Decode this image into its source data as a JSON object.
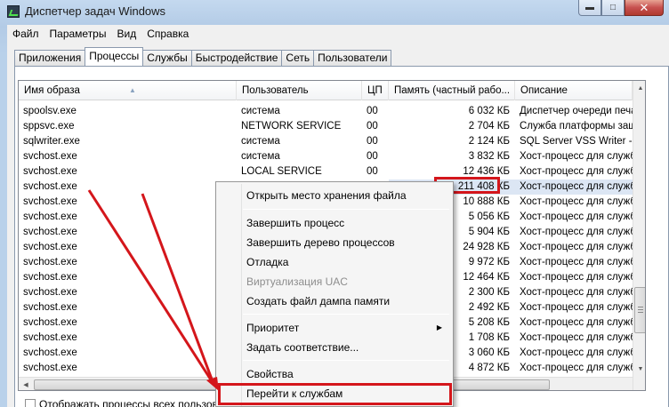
{
  "window": {
    "title": "Диспетчер задач Windows",
    "min_glyph": "▬",
    "max_glyph": "□",
    "close_glyph": "✕"
  },
  "menu": [
    "Файл",
    "Параметры",
    "Вид",
    "Справка"
  ],
  "tabs": [
    "Приложения",
    "Процессы",
    "Службы",
    "Быстродействие",
    "Сеть",
    "Пользователи"
  ],
  "active_tab": "Процессы",
  "columns": [
    "Имя образа",
    "Пользователь",
    "ЦП",
    "Память (частный рабо...",
    "Описание"
  ],
  "rows": [
    {
      "name": "spoolsv.exe",
      "user": "система",
      "cpu": "00",
      "mem": "6 032 КБ",
      "desc": "Диспетчер очереди печа"
    },
    {
      "name": "sppsvc.exe",
      "user": "NETWORK SERVICE",
      "cpu": "00",
      "mem": "2 704 КБ",
      "desc": "Служба платформы защ"
    },
    {
      "name": "sqlwriter.exe",
      "user": "система",
      "cpu": "00",
      "mem": "2 124 КБ",
      "desc": "SQL Server VSS Writer - 6"
    },
    {
      "name": "svchost.exe",
      "user": "система",
      "cpu": "00",
      "mem": "3 832 КБ",
      "desc": "Хост-процесс для служб"
    },
    {
      "name": "svchost.exe",
      "user": "LOCAL SERVICE",
      "cpu": "00",
      "mem": "12 436 КБ",
      "desc": "Хост-процесс для служб"
    },
    {
      "name": "svchost.exe",
      "user": "",
      "cpu": "",
      "mem": "211 408 КБ",
      "desc": "Хост-процесс для служб"
    },
    {
      "name": "svchost.exe",
      "user": "",
      "cpu": "",
      "mem": "10 888 КБ",
      "desc": "Хост-процесс для служб"
    },
    {
      "name": "svchost.exe",
      "user": "",
      "cpu": "",
      "mem": "5 056 КБ",
      "desc": "Хост-процесс для служб"
    },
    {
      "name": "svchost.exe",
      "user": "",
      "cpu": "",
      "mem": "5 904 КБ",
      "desc": "Хост-процесс для служб"
    },
    {
      "name": "svchost.exe",
      "user": "",
      "cpu": "",
      "mem": "24 928 КБ",
      "desc": "Хост-процесс для служб"
    },
    {
      "name": "svchost.exe",
      "user": "",
      "cpu": "",
      "mem": "9 972 КБ",
      "desc": "Хост-процесс для служб"
    },
    {
      "name": "svchost.exe",
      "user": "",
      "cpu": "",
      "mem": "12 464 КБ",
      "desc": "Хост-процесс для служб"
    },
    {
      "name": "svchost.exe",
      "user": "",
      "cpu": "",
      "mem": "2 300 КБ",
      "desc": "Хост-процесс для служб"
    },
    {
      "name": "svchost.exe",
      "user": "",
      "cpu": "",
      "mem": "2 492 КБ",
      "desc": "Хост-процесс для служб"
    },
    {
      "name": "svchost.exe",
      "user": "",
      "cpu": "",
      "mem": "5 208 КБ",
      "desc": "Хост-процесс для служб"
    },
    {
      "name": "svchost.exe",
      "user": "",
      "cpu": "",
      "mem": "1 708 КБ",
      "desc": "Хост-процесс для служб"
    },
    {
      "name": "svchost.exe",
      "user": "",
      "cpu": "",
      "mem": "3 060 КБ",
      "desc": "Хост-процесс для служб"
    },
    {
      "name": "svchost.exe",
      "user": "",
      "cpu": "",
      "mem": "4 872 КБ",
      "desc": "Хост-процесс для служб"
    }
  ],
  "selected_row": 5,
  "context_menu": [
    {
      "label": "Открыть место хранения файла",
      "disabled": false
    },
    {
      "label": "Завершить процесс",
      "disabled": false
    },
    {
      "label": "Завершить дерево процессов",
      "disabled": false
    },
    {
      "label": "Отладка",
      "disabled": false
    },
    {
      "label": "Виртуализация UAC",
      "disabled": true
    },
    {
      "label": "Создать файл дампа памяти",
      "disabled": false
    },
    {
      "label": "Приоритет",
      "disabled": false,
      "submenu": true
    },
    {
      "label": "Задать соответствие...",
      "disabled": false
    },
    {
      "label": "Свойства",
      "disabled": false
    },
    {
      "label": "Перейти к службам",
      "disabled": false
    }
  ],
  "bottom_checkbox": "Отображать процессы всех пользователей",
  "annotation_color": "#d4161b"
}
